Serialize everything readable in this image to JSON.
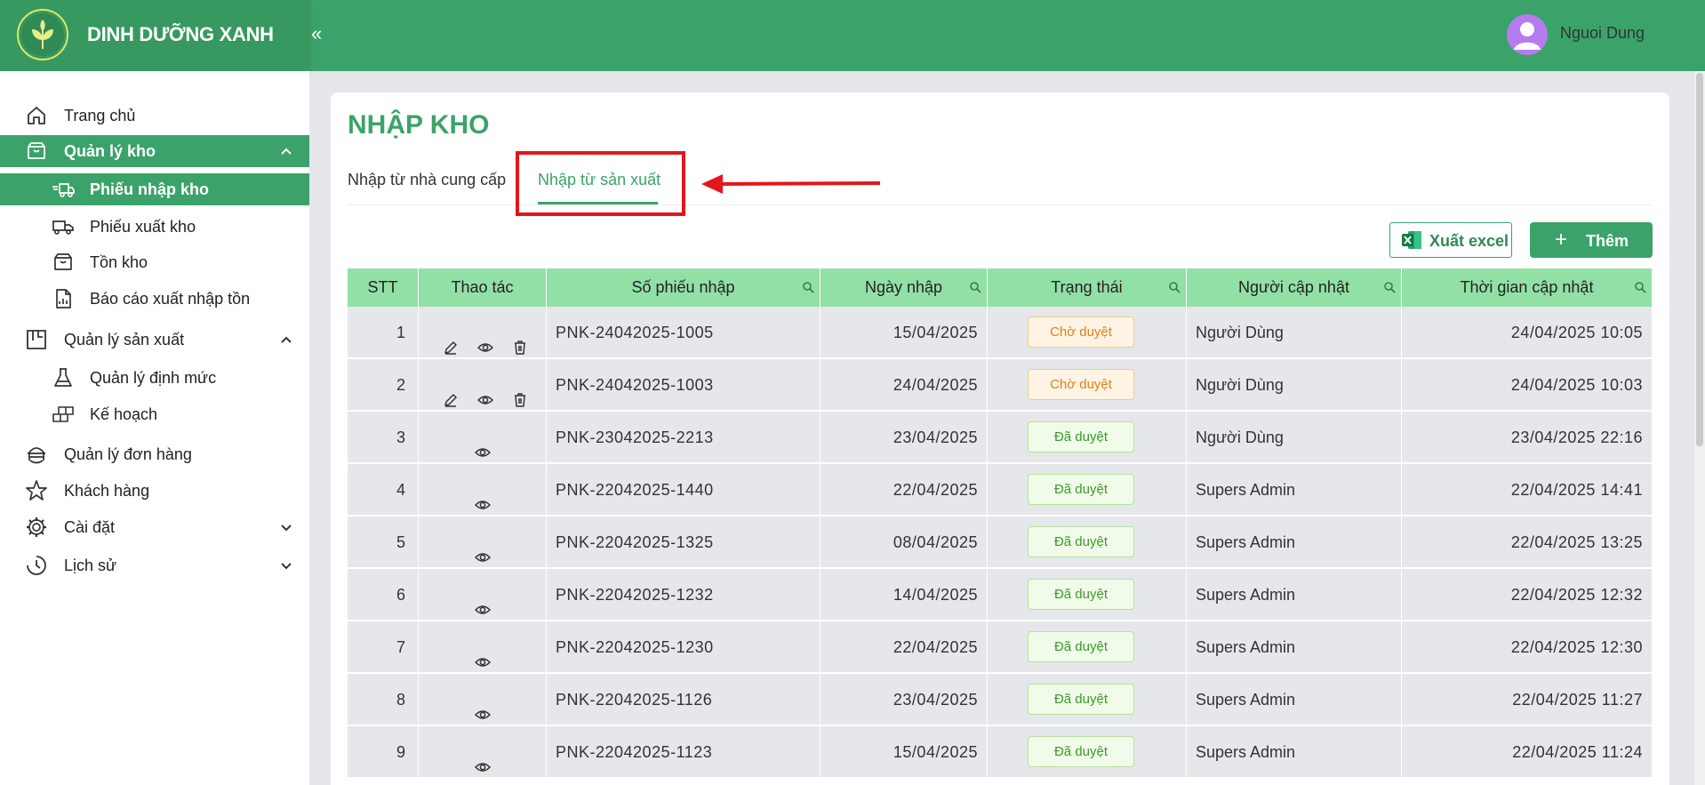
{
  "header": {
    "brand": "DINH DƯỠNG XANH",
    "collapse_label": "«",
    "user_name": "Nguoi Dung"
  },
  "sidebar": {
    "items": [
      {
        "label": "Trang chủ",
        "icon": "home-icon"
      },
      {
        "label": "Quản lý kho",
        "icon": "inbox-icon",
        "expanded": true
      },
      {
        "label": "Quản lý sản xuất",
        "icon": "factory-icon",
        "expanded": true
      },
      {
        "label": "Quản lý đơn hàng",
        "icon": "order-icon"
      },
      {
        "label": "Khách hàng",
        "icon": "star-icon"
      },
      {
        "label": "Cài đặt",
        "icon": "gear-icon",
        "expanded": false
      },
      {
        "label": "Lịch sử",
        "icon": "history-icon",
        "expanded": false
      }
    ],
    "kho_children": [
      {
        "label": "Phiếu nhập kho",
        "icon": "truck-in-icon",
        "active": true
      },
      {
        "label": "Phiếu xuất kho",
        "icon": "truck-out-icon"
      },
      {
        "label": "Tồn kho",
        "icon": "inbox-icon"
      },
      {
        "label": "Báo cáo xuất nhập tồn",
        "icon": "report-icon"
      }
    ],
    "sx_children": [
      {
        "label": "Quản lý định mức",
        "icon": "flask-icon"
      },
      {
        "label": "Kế hoạch",
        "icon": "blocks-icon"
      }
    ]
  },
  "page": {
    "title": "NHẬP KHO",
    "tabs": [
      {
        "label": "Nhập từ nhà cung cấp",
        "active": false
      },
      {
        "label": "Nhập từ sản xuất",
        "active": true
      }
    ],
    "export_label": "Xuất excel",
    "add_label": "Thêm",
    "add_plus": "+"
  },
  "colors": {
    "primary": "#3ba36a",
    "table_header": "#92e0a6",
    "highlight": "#e3161c"
  },
  "table": {
    "columns": [
      "STT",
      "Thao tác",
      "Số phiếu nhập",
      "Ngày nhập",
      "Trạng thái",
      "Người cập nhật",
      "Thời gian cập nhật"
    ],
    "rows": [
      {
        "stt": "1",
        "actions": [
          "edit",
          "view",
          "delete"
        ],
        "so_phieu": "PNK-24042025-1005",
        "ngay_nhap": "15/04/2025",
        "trang_thai": "Chờ duyệt",
        "status": "pending",
        "nguoi": "Người Dùng",
        "thoi_gian": "24/04/2025 10:05"
      },
      {
        "stt": "2",
        "actions": [
          "edit",
          "view",
          "delete"
        ],
        "so_phieu": "PNK-24042025-1003",
        "ngay_nhap": "24/04/2025",
        "trang_thai": "Chờ duyệt",
        "status": "pending",
        "nguoi": "Người Dùng",
        "thoi_gian": "24/04/2025 10:03"
      },
      {
        "stt": "3",
        "actions": [
          "view"
        ],
        "so_phieu": "PNK-23042025-2213",
        "ngay_nhap": "23/04/2025",
        "trang_thai": "Đã duyệt",
        "status": "ok",
        "nguoi": "Người Dùng",
        "thoi_gian": "23/04/2025 22:16"
      },
      {
        "stt": "4",
        "actions": [
          "view"
        ],
        "so_phieu": "PNK-22042025-1440",
        "ngay_nhap": "22/04/2025",
        "trang_thai": "Đã duyệt",
        "status": "ok",
        "nguoi": "Supers Admin",
        "thoi_gian": "22/04/2025 14:41"
      },
      {
        "stt": "5",
        "actions": [
          "view"
        ],
        "so_phieu": "PNK-22042025-1325",
        "ngay_nhap": "08/04/2025",
        "trang_thai": "Đã duyệt",
        "status": "ok",
        "nguoi": "Supers Admin",
        "thoi_gian": "22/04/2025 13:25"
      },
      {
        "stt": "6",
        "actions": [
          "view"
        ],
        "so_phieu": "PNK-22042025-1232",
        "ngay_nhap": "14/04/2025",
        "trang_thai": "Đã duyệt",
        "status": "ok",
        "nguoi": "Supers Admin",
        "thoi_gian": "22/04/2025 12:32"
      },
      {
        "stt": "7",
        "actions": [
          "view"
        ],
        "so_phieu": "PNK-22042025-1230",
        "ngay_nhap": "22/04/2025",
        "trang_thai": "Đã duyệt",
        "status": "ok",
        "nguoi": "Supers Admin",
        "thoi_gian": "22/04/2025 12:30"
      },
      {
        "stt": "8",
        "actions": [
          "view"
        ],
        "so_phieu": "PNK-22042025-1126",
        "ngay_nhap": "23/04/2025",
        "trang_thai": "Đã duyệt",
        "status": "ok",
        "nguoi": "Supers Admin",
        "thoi_gian": "22/04/2025 11:27"
      },
      {
        "stt": "9",
        "actions": [
          "view"
        ],
        "so_phieu": "PNK-22042025-1123",
        "ngay_nhap": "15/04/2025",
        "trang_thai": "Đã duyệt",
        "status": "ok",
        "nguoi": "Supers Admin",
        "thoi_gian": "22/04/2025 11:24"
      }
    ]
  }
}
